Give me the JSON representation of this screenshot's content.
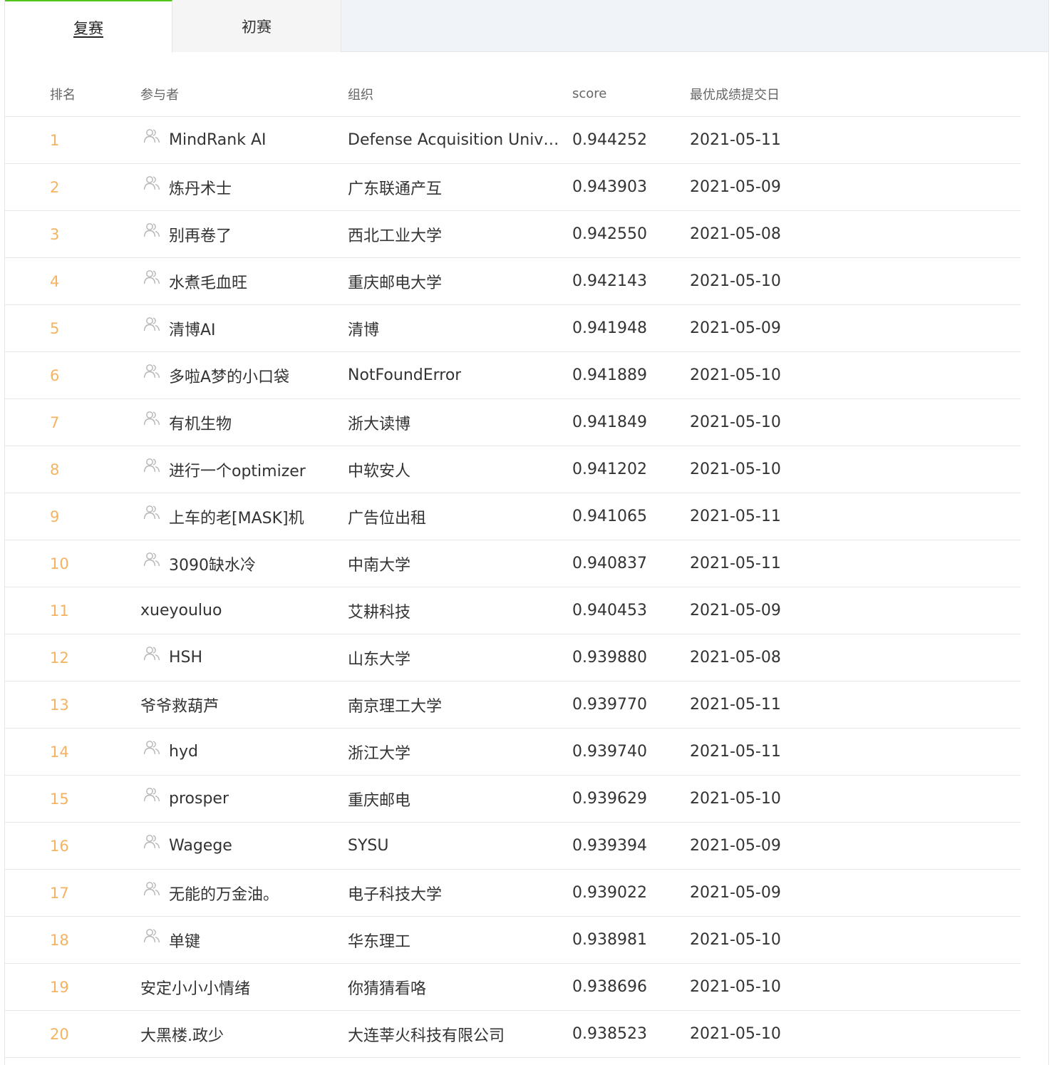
{
  "tabs": [
    {
      "label": "复赛",
      "active": true
    },
    {
      "label": "初赛",
      "active": false
    }
  ],
  "columns": [
    "排名",
    "参与者",
    "组织",
    "score",
    "最优成绩提交日"
  ],
  "colors": {
    "rank": "#f5b362",
    "active_tab_accent": "#52c41a"
  },
  "rows": [
    {
      "rank": "1",
      "team": true,
      "name": "MindRank AI",
      "org": "Defense Acquisition Univer...",
      "score": "0.944252",
      "date": "2021-05-11"
    },
    {
      "rank": "2",
      "team": true,
      "name": "炼丹术士",
      "org": "广东联通产互",
      "score": "0.943903",
      "date": "2021-05-09"
    },
    {
      "rank": "3",
      "team": true,
      "name": "别再卷了",
      "org": "西北工业大学",
      "score": "0.942550",
      "date": "2021-05-08"
    },
    {
      "rank": "4",
      "team": true,
      "name": "水煮毛血旺",
      "org": "重庆邮电大学",
      "score": "0.942143",
      "date": "2021-05-10"
    },
    {
      "rank": "5",
      "team": true,
      "name": "清博AI",
      "org": "清博",
      "score": "0.941948",
      "date": "2021-05-09"
    },
    {
      "rank": "6",
      "team": true,
      "name": "多啦A梦的小口袋",
      "org": "NotFoundError",
      "score": "0.941889",
      "date": "2021-05-10"
    },
    {
      "rank": "7",
      "team": true,
      "name": "有机生物",
      "org": "浙大读博",
      "score": "0.941849",
      "date": "2021-05-10"
    },
    {
      "rank": "8",
      "team": true,
      "name": "进行一个optimizer",
      "org": "中软安人",
      "score": "0.941202",
      "date": "2021-05-10"
    },
    {
      "rank": "9",
      "team": true,
      "name": "上车的老[MASK]机",
      "org": "广告位出租",
      "score": "0.941065",
      "date": "2021-05-11"
    },
    {
      "rank": "10",
      "team": true,
      "name": "3090缺水冷",
      "org": "中南大学",
      "score": "0.940837",
      "date": "2021-05-11"
    },
    {
      "rank": "11",
      "team": false,
      "name": "xueyouluo",
      "org": "艾耕科技",
      "score": "0.940453",
      "date": "2021-05-09"
    },
    {
      "rank": "12",
      "team": true,
      "name": "HSH",
      "org": "山东大学",
      "score": "0.939880",
      "date": "2021-05-08"
    },
    {
      "rank": "13",
      "team": false,
      "name": "爷爷救葫芦",
      "org": "南京理工大学",
      "score": "0.939770",
      "date": "2021-05-11"
    },
    {
      "rank": "14",
      "team": true,
      "name": "hyd",
      "org": "浙江大学",
      "score": "0.939740",
      "date": "2021-05-11"
    },
    {
      "rank": "15",
      "team": true,
      "name": "prosper",
      "org": "重庆邮电",
      "score": "0.939629",
      "date": "2021-05-10"
    },
    {
      "rank": "16",
      "team": true,
      "name": "Wagege",
      "org": "SYSU",
      "score": "0.939394",
      "date": "2021-05-09"
    },
    {
      "rank": "17",
      "team": true,
      "name": "无能的万金油。",
      "org": "电子科技大学",
      "score": "0.939022",
      "date": "2021-05-09"
    },
    {
      "rank": "18",
      "team": true,
      "name": "单键",
      "org": "华东理工",
      "score": "0.938981",
      "date": "2021-05-10"
    },
    {
      "rank": "19",
      "team": false,
      "name": "安定小小小情绪",
      "org": "你猜猜看咯",
      "score": "0.938696",
      "date": "2021-05-10"
    },
    {
      "rank": "20",
      "team": false,
      "name": "大黑楼.政少",
      "org": "大连莘火科技有限公司",
      "score": "0.938523",
      "date": "2021-05-10"
    }
  ]
}
